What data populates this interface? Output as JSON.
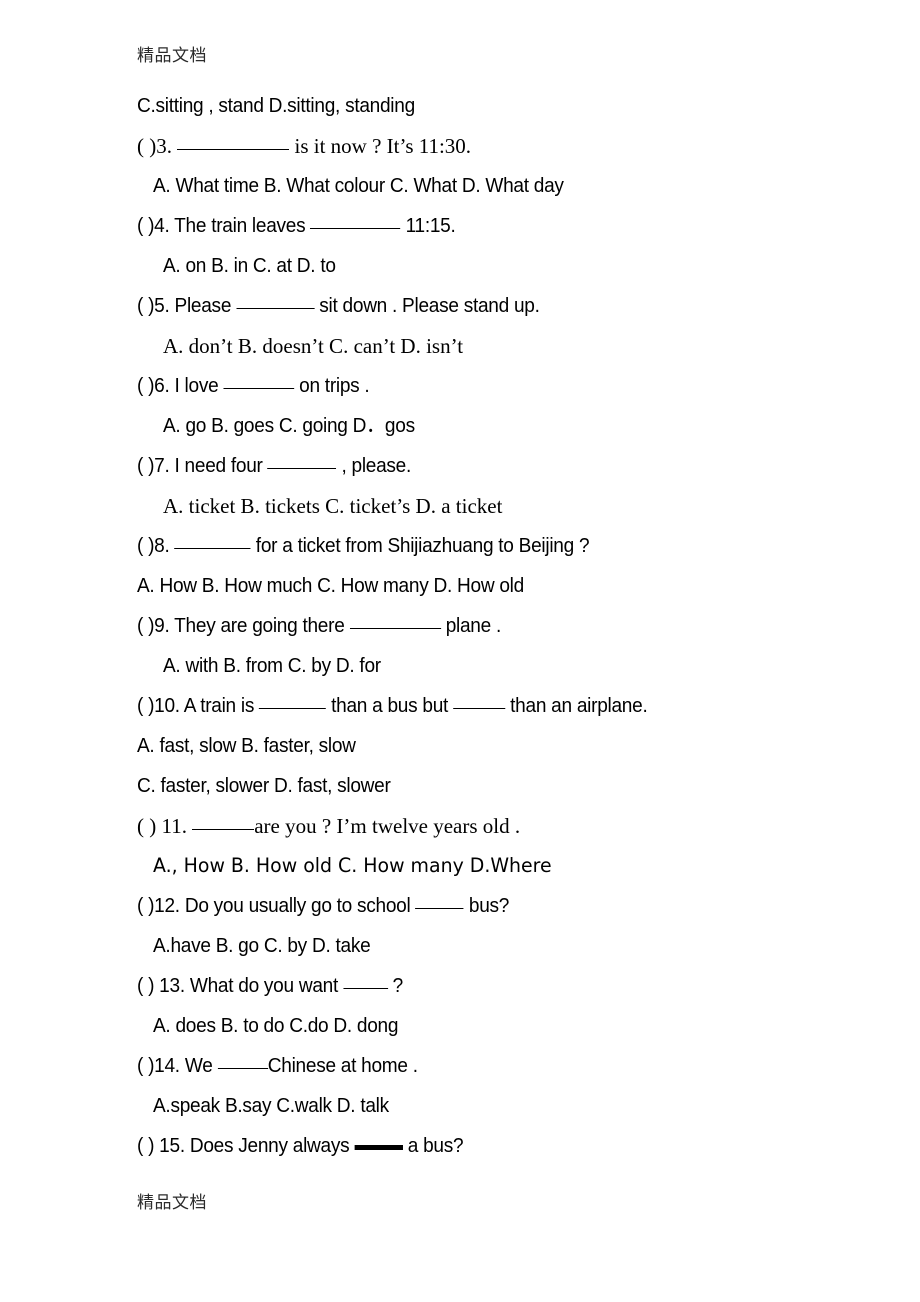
{
  "watermark": {
    "top": "精品文档",
    "bottom": "精品文档"
  },
  "document": {
    "type": "english-multiple-choice-worksheet",
    "lines": [
      {
        "id": "q2-options-cd",
        "kind": "options",
        "text": "C.sitting , stand        D.sitting, standing"
      },
      {
        "id": "q3-stem-a",
        "kind": "stem",
        "text": "(   )3. "
      },
      {
        "id": "q3-stem-b",
        "kind": "stem",
        "text": " is it now ? It’s 11:30."
      },
      {
        "id": "q3-options",
        "kind": "options",
        "text": "A. What time  B. What colour  C. What  D. What day"
      },
      {
        "id": "q4-stem-a",
        "kind": "stem",
        "text": "(   )4. The train leaves "
      },
      {
        "id": "q4-stem-b",
        "kind": "stem",
        "text": " 11:15."
      },
      {
        "id": "q4-options",
        "kind": "options",
        "text": "A. on      B. in      C. at        D. to"
      },
      {
        "id": "q5-stem-a",
        "kind": "stem",
        "text": "(   )5.  Please "
      },
      {
        "id": "q5-stem-b",
        "kind": "stem",
        "text": " sit down . Please stand up."
      },
      {
        "id": "q5-options",
        "kind": "options",
        "text": "A. don’t   B. doesn’t   C. can’t    D. isn’t"
      },
      {
        "id": "q6-stem-a",
        "kind": "stem",
        "text": "(   )6. I love "
      },
      {
        "id": "q6-stem-b",
        "kind": "stem",
        "text": " on trips ."
      },
      {
        "id": "q6-options",
        "kind": "options",
        "text": "A. go     B. goes     C. going     D．gos"
      },
      {
        "id": "q7-stem-a",
        "kind": "stem",
        "text": "(   )7. I need four "
      },
      {
        "id": "q7-stem-b",
        "kind": "stem",
        "text": " , please."
      },
      {
        "id": "q7-options",
        "kind": "options",
        "text": "A. ticket   B. tickets   C. ticket’s   D. a ticket"
      },
      {
        "id": "q8-stem-a",
        "kind": "stem",
        "text": "(   )8. "
      },
      {
        "id": "q8-stem-b",
        "kind": "stem",
        "text": " for a ticket from Shijiazhuang to Beijing ?"
      },
      {
        "id": "q8-options",
        "kind": "options",
        "text": "A. How   B. How much  C. How many  D. How old"
      },
      {
        "id": "q9-stem-a",
        "kind": "stem",
        "text": "(   )9. They are going there "
      },
      {
        "id": "q9-stem-b",
        "kind": "stem",
        "text": " plane ."
      },
      {
        "id": "q9-options",
        "kind": "options",
        "text": "A. with     B. from      C. by        D. for"
      },
      {
        "id": "q10-stem-a",
        "kind": "stem",
        "text": "(   )10. A train is "
      },
      {
        "id": "q10-stem-b",
        "kind": "stem",
        "text": " than a bus but "
      },
      {
        "id": "q10-stem-c",
        "kind": "stem",
        "text": " than an airplane."
      },
      {
        "id": "q10-options-ab",
        "kind": "options",
        "text": "A. fast, slow              B. faster, slow"
      },
      {
        "id": "q10-options-cd",
        "kind": "options",
        "text": "C. faster, slower            D. fast, slower"
      },
      {
        "id": "q11-stem-a",
        "kind": "stem",
        "text": "(  ) 11. "
      },
      {
        "id": "q11-stem-b",
        "kind": "stem",
        "text": "are you ? I’m twelve years old ."
      },
      {
        "id": "q11-options",
        "kind": "options",
        "text": "A., How      B. How  old     C. How  many     D.Where"
      },
      {
        "id": "q12-stem-a",
        "kind": "stem",
        "text": "(   )12. Do you usually go to school  "
      },
      {
        "id": "q12-stem-b",
        "kind": "stem",
        "text": " bus?"
      },
      {
        "id": "q12-options",
        "kind": "options",
        "text": "A.have    B. go       C. by       D. take"
      },
      {
        "id": "q13-stem-a",
        "kind": "stem",
        "text": "(  ) 13. What do you want  "
      },
      {
        "id": "q13-stem-b",
        "kind": "stem",
        "text": "  ?"
      },
      {
        "id": "q13-options",
        "kind": "options",
        "text": "A. does   B. to do    C.do        D. dong"
      },
      {
        "id": "q14-stem-a",
        "kind": "stem",
        "text": "(   )14. We  "
      },
      {
        "id": "q14-stem-b",
        "kind": "stem",
        "text": "Chinese at home ."
      },
      {
        "id": "q14-options",
        "kind": "options",
        "text": "A.speak   B.say     C.walk      D. talk"
      },
      {
        "id": "q15-stem-a",
        "kind": "stem",
        "text": "(  ) 15. Does Jenny always  "
      },
      {
        "id": "q15-stem-b",
        "kind": "stem",
        "text": " a bus?"
      }
    ]
  }
}
